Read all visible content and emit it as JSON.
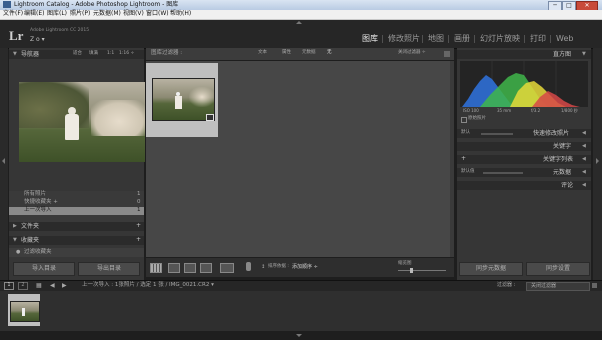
{
  "window": {
    "title": "Lightroom Catalog - Adobe Photoshop Lightroom - 图库",
    "controls": [
      "─",
      "□",
      "✕"
    ]
  },
  "menu": [
    "文件(F)",
    "编辑(E)",
    "图库(L)",
    "照片(P)",
    "元数据(M)",
    "视图(V)",
    "窗口(W)",
    "帮助(H)"
  ],
  "identity": {
    "logo": "Lr",
    "app_name": "Adobe Lightroom CC 2015",
    "user": "Z o ▾"
  },
  "modules": [
    "图库",
    "修改照片",
    "地图",
    "画册",
    "幻灯片放映",
    "打印",
    "Web"
  ],
  "active_module": "图库",
  "left_panel": {
    "navigator": {
      "title": "导航器",
      "zoom_options": [
        "适合",
        "填满",
        "1:1",
        "1:16 ÷"
      ]
    },
    "catalog_items": [
      {
        "label": "所有照片",
        "count": "1"
      },
      {
        "label": "快捷收藏夹 +",
        "count": "0"
      },
      {
        "label": "上一次导入",
        "count": "1"
      }
    ],
    "folders": {
      "title": "文件夹",
      "action": "+"
    },
    "collections": {
      "title": "收藏夹",
      "action": "+",
      "items": [
        {
          "label": "过滤收藏夹"
        }
      ]
    },
    "import_button": "导入目录",
    "export_button": "导出目录"
  },
  "library_filter": {
    "label": "图库过滤器 :",
    "options": [
      "文本",
      "属性",
      "元数据",
      "无"
    ],
    "preset": "关闭过滤器 ÷"
  },
  "toolbar": {
    "sort_label": "排序依据 :",
    "sort_value": "添加顺序 ÷",
    "thumbnails_label": "缩览图"
  },
  "right_panel": {
    "histogram": {
      "title": "直方图",
      "info": [
        "ISO 100",
        "35 mm",
        "f/3.2",
        "1/800 秒"
      ],
      "original_photo": "原始照片"
    },
    "quick_develop": {
      "preset": "默认",
      "title": "快速修改照片"
    },
    "keywording": {
      "title": "关键字"
    },
    "keyword_list": {
      "title": "关键字列表",
      "action": "+"
    },
    "metadata": {
      "preset": "默认值",
      "title": "元数据"
    },
    "comments": {
      "title": "评论"
    },
    "sync_metadata_button": "同步元数据",
    "sync_settings_button": "同步设置"
  },
  "filmstrip": {
    "pages": [
      "1",
      "2"
    ],
    "source": "上一次导入 : 1张照片 / 选定 1 张 / IMG_0021.CR2 ▾",
    "filter_label": "过滤器 :",
    "filter_value": "关闭过滤器"
  },
  "colors": {
    "background": "#1e1e1e",
    "panel": "#363636",
    "grid": "#474747",
    "selected_cell": "#bfbfbf"
  },
  "chart_data": {
    "type": "area",
    "series": [
      {
        "color": "#2f6fd6"
      },
      {
        "color": "#3fb64a"
      },
      {
        "color": "#e6d93a"
      },
      {
        "color": "#d64848"
      }
    ]
  }
}
